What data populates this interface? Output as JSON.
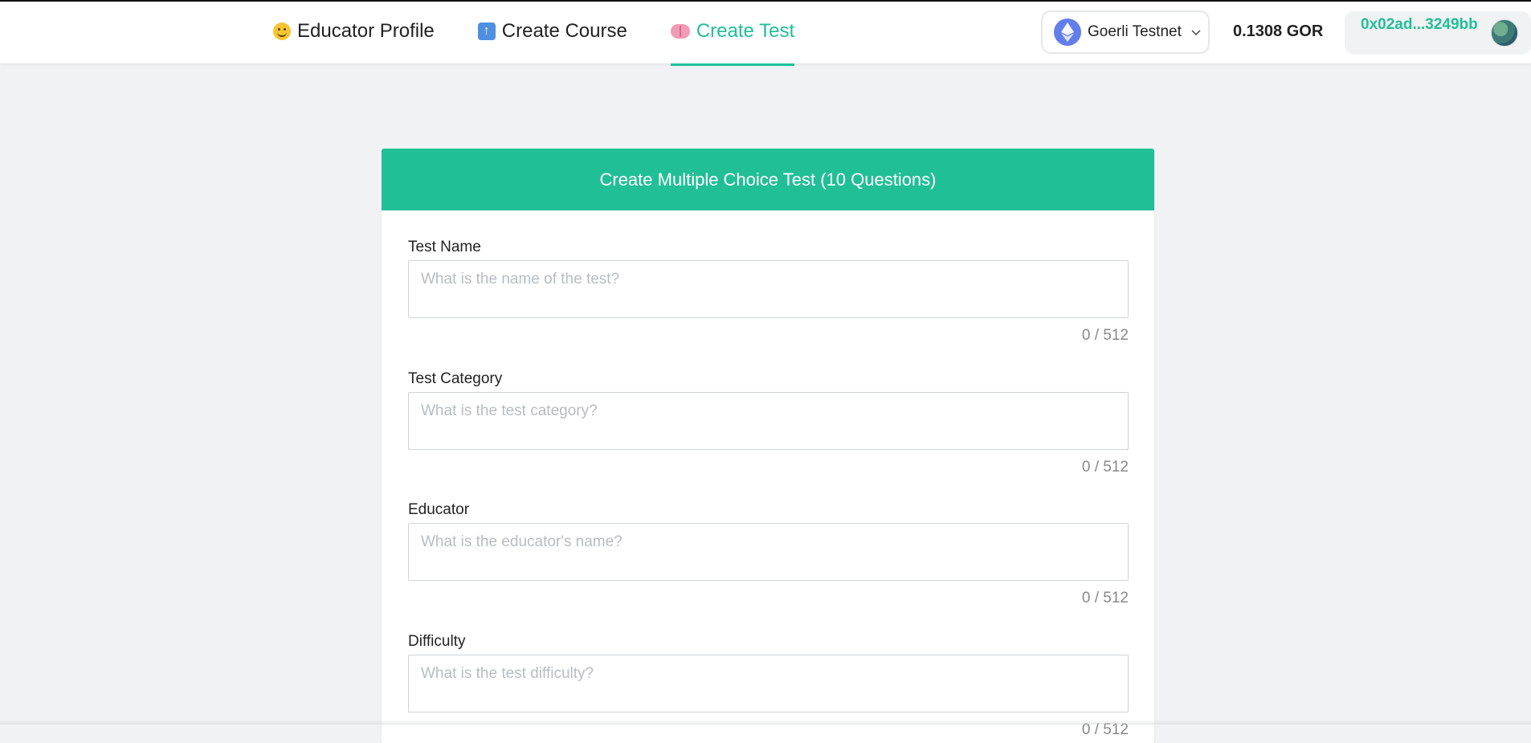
{
  "nav": {
    "tabs": [
      {
        "label": "Educator Profile",
        "icon": "smiley-face-icon"
      },
      {
        "label": "Create Course",
        "icon": "up-arrow-icon"
      },
      {
        "label": "Create Test",
        "icon": "brain-icon",
        "active": true
      }
    ]
  },
  "wallet": {
    "network": "Goerli Testnet",
    "balance": "0.1308 GOR",
    "address": "0x02ad...3249bb"
  },
  "form": {
    "title": "Create Multiple Choice Test (10 Questions)",
    "fields": [
      {
        "label": "Test Name",
        "placeholder": "What is the name of the test?",
        "value": "",
        "counter": "0 / 512"
      },
      {
        "label": "Test Category",
        "placeholder": "What is the test category?",
        "value": "",
        "counter": "0 / 512"
      },
      {
        "label": "Educator",
        "placeholder": "What is the educator's name?",
        "value": "",
        "counter": "0 / 512"
      },
      {
        "label": "Difficulty",
        "placeholder": "What is the test difficulty?",
        "value": "",
        "counter": "0 / 512"
      }
    ]
  },
  "colors": {
    "accent": "#21bf96",
    "background": "#f0f2f5",
    "ethereum": "#627eea"
  }
}
